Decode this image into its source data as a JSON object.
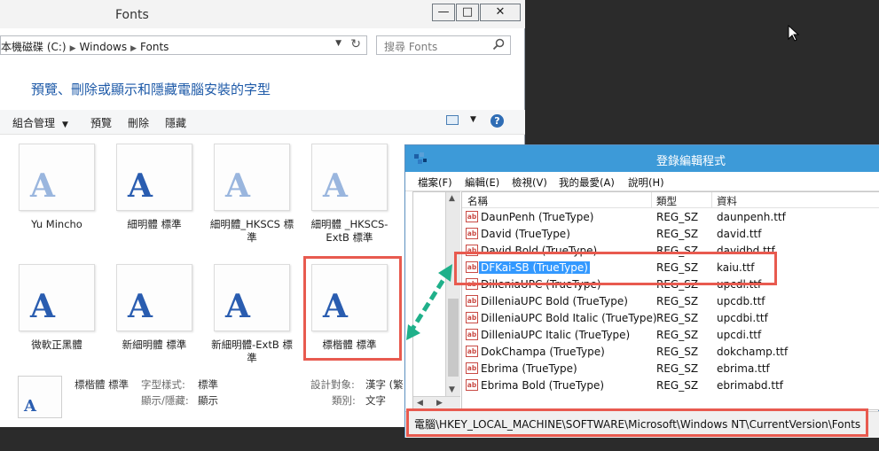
{
  "explorer": {
    "title": "Fonts",
    "controls": {
      "minimize": "—",
      "maximize": "□",
      "close": "✕"
    },
    "breadcrumb": [
      "本機磁碟 (C:)",
      "Windows",
      "Fonts"
    ],
    "search_placeholder": "搜尋 Fonts",
    "heading": "預覽、刪除或顯示和隱藏電腦安裝的字型",
    "toolbar": {
      "organize": "組合管理",
      "preview": "預覽",
      "delete": "刪除",
      "hide": "隱藏"
    },
    "tiles": [
      {
        "label": "Yu Mincho",
        "glyph": "A"
      },
      {
        "label": "細明體 標準",
        "glyph": "A"
      },
      {
        "label": "細明體_HKSCS 標準",
        "glyph": "A"
      },
      {
        "label": "細明體 _HKSCS-ExtB 標準",
        "glyph": "A"
      },
      {
        "label": "微軟正黑體",
        "glyph": "A"
      },
      {
        "label": "新細明體 標準",
        "glyph": "A"
      },
      {
        "label": "新細明體-ExtB 標準",
        "glyph": "A"
      },
      {
        "label": "標楷體 標準",
        "glyph": "A"
      }
    ],
    "details": {
      "name": "標楷體 標準",
      "style_label": "字型樣式:",
      "style_value": "標準",
      "visibility_label": "顯示/隱藏:",
      "visibility_value": "顯示",
      "designed_for_label": "設計對象:",
      "designed_for_value": "漢字 (繁",
      "category_label": "類別:",
      "category_value": "文字",
      "thumb_glyph": "A"
    }
  },
  "regedit": {
    "title": "登錄編輯程式",
    "menu": [
      "檔案(F)",
      "編輯(E)",
      "檢視(V)",
      "我的最愛(A)",
      "說明(H)"
    ],
    "columns": {
      "name": "名稱",
      "type": "類型",
      "data": "資料"
    },
    "icon_text": "ab",
    "rows": [
      {
        "name": "DaunPenh (TrueType)",
        "type": "REG_SZ",
        "data": "daunpenh.ttf"
      },
      {
        "name": "David (TrueType)",
        "type": "REG_SZ",
        "data": "david.ttf"
      },
      {
        "name": "David Bold (TrueType)",
        "type": "REG_SZ",
        "data": "davidbd.ttf"
      },
      {
        "name": "DFKai-SB (TrueType)",
        "type": "REG_SZ",
        "data": "kaiu.ttf",
        "selected": true
      },
      {
        "name": "DilleniaUPC (TrueType)",
        "type": "REG_SZ",
        "data": "upcdl.ttf"
      },
      {
        "name": "DilleniaUPC Bold (TrueType)",
        "type": "REG_SZ",
        "data": "upcdb.ttf"
      },
      {
        "name": "DilleniaUPC Bold Italic (TrueType)",
        "type": "REG_SZ",
        "data": "upcdbi.ttf"
      },
      {
        "name": "DilleniaUPC Italic (TrueType)",
        "type": "REG_SZ",
        "data": "upcdi.ttf"
      },
      {
        "name": "DokChampa (TrueType)",
        "type": "REG_SZ",
        "data": "dokchamp.ttf"
      },
      {
        "name": "Ebrima (TrueType)",
        "type": "REG_SZ",
        "data": "ebrima.ttf"
      },
      {
        "name": "Ebrima Bold (TrueType)",
        "type": "REG_SZ",
        "data": "ebrimabd.ttf"
      }
    ],
    "status_path": "電腦\\HKEY_LOCAL_MACHINE\\SOFTWARE\\Microsoft\\Windows NT\\CurrentVersion\\Fonts"
  },
  "colors": {
    "highlight": "#e85a4f",
    "accent": "#3d9ad8",
    "arrow": "#1fb08a",
    "selection": "#3399ff"
  }
}
